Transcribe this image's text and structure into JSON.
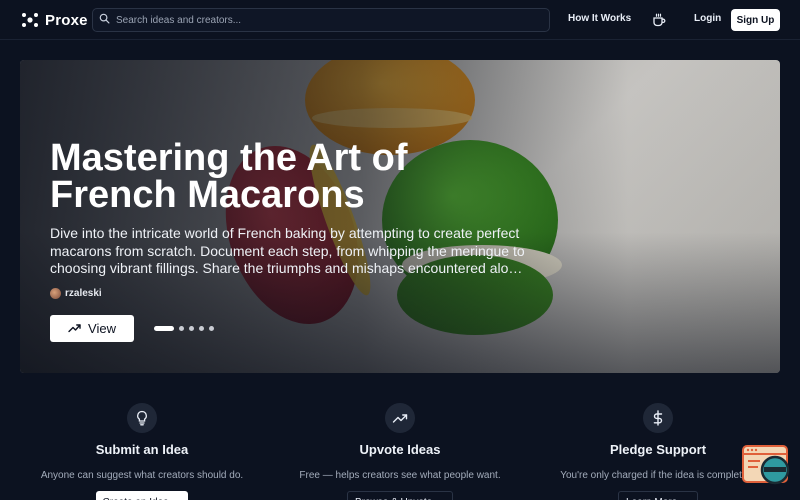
{
  "header": {
    "brand": "Proxe",
    "search_placeholder": "Search ideas and creators...",
    "nav_how": "How It Works",
    "nav_login": "Login",
    "nav_signup": "Sign Up",
    "icons": [
      "logo-icon",
      "search-icon",
      "coffee-cup-icon"
    ]
  },
  "hero": {
    "title": "Mastering the Art of French Macarons",
    "description": "Dive into the intricate world of French baking by attempting to create perfect macarons from scratch. Document each step, from whipping the meringue to choosing vibrant fillings. Share the triumphs and mishaps encountered along the way.",
    "author": "rzaleski",
    "view_label": "View",
    "slide_count": 5,
    "active_slide": 1
  },
  "features": [
    {
      "title": "Submit an Idea",
      "desc": "Anyone can suggest what creators should do.",
      "button": "Create an Idea →",
      "icon": "lightbulb-icon"
    },
    {
      "title": "Upvote Ideas",
      "desc": "Free — helps creators see what people want.",
      "button": "Browse & Upvote →",
      "icon": "trending-up-icon"
    },
    {
      "title": "Pledge Support",
      "desc": "You're only charged if the idea is completed.",
      "button": "Learn More →",
      "icon": "dollar-icon"
    }
  ],
  "colors": {
    "background": "#0c1220",
    "accent": "#ffffff",
    "macaron_orange": "#e8a020",
    "macaron_red": "#c0303a",
    "macaron_green": "#3f9a2a"
  }
}
